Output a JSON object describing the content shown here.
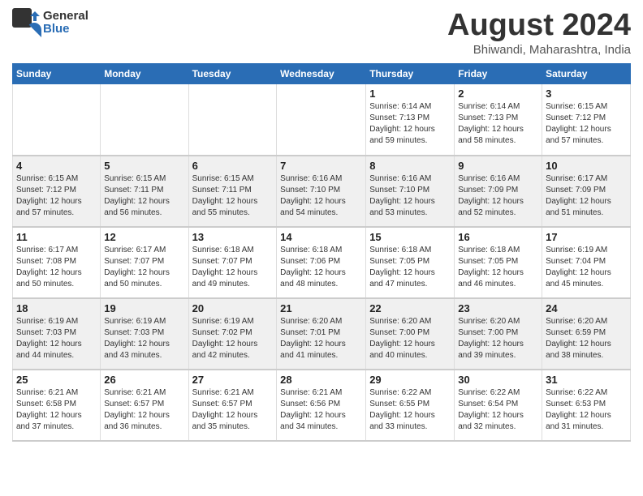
{
  "header": {
    "logo_general": "General",
    "logo_blue": "Blue",
    "main_title": "August 2024",
    "subtitle": "Bhiwandi, Maharashtra, India"
  },
  "weekdays": [
    "Sunday",
    "Monday",
    "Tuesday",
    "Wednesday",
    "Thursday",
    "Friday",
    "Saturday"
  ],
  "weeks": [
    {
      "days": [
        {
          "num": "",
          "info": ""
        },
        {
          "num": "",
          "info": ""
        },
        {
          "num": "",
          "info": ""
        },
        {
          "num": "",
          "info": ""
        },
        {
          "num": "1",
          "info": "Sunrise: 6:14 AM\nSunset: 7:13 PM\nDaylight: 12 hours\nand 59 minutes."
        },
        {
          "num": "2",
          "info": "Sunrise: 6:14 AM\nSunset: 7:13 PM\nDaylight: 12 hours\nand 58 minutes."
        },
        {
          "num": "3",
          "info": "Sunrise: 6:15 AM\nSunset: 7:12 PM\nDaylight: 12 hours\nand 57 minutes."
        }
      ]
    },
    {
      "days": [
        {
          "num": "4",
          "info": "Sunrise: 6:15 AM\nSunset: 7:12 PM\nDaylight: 12 hours\nand 57 minutes."
        },
        {
          "num": "5",
          "info": "Sunrise: 6:15 AM\nSunset: 7:11 PM\nDaylight: 12 hours\nand 56 minutes."
        },
        {
          "num": "6",
          "info": "Sunrise: 6:15 AM\nSunset: 7:11 PM\nDaylight: 12 hours\nand 55 minutes."
        },
        {
          "num": "7",
          "info": "Sunrise: 6:16 AM\nSunset: 7:10 PM\nDaylight: 12 hours\nand 54 minutes."
        },
        {
          "num": "8",
          "info": "Sunrise: 6:16 AM\nSunset: 7:10 PM\nDaylight: 12 hours\nand 53 minutes."
        },
        {
          "num": "9",
          "info": "Sunrise: 6:16 AM\nSunset: 7:09 PM\nDaylight: 12 hours\nand 52 minutes."
        },
        {
          "num": "10",
          "info": "Sunrise: 6:17 AM\nSunset: 7:09 PM\nDaylight: 12 hours\nand 51 minutes."
        }
      ]
    },
    {
      "days": [
        {
          "num": "11",
          "info": "Sunrise: 6:17 AM\nSunset: 7:08 PM\nDaylight: 12 hours\nand 50 minutes."
        },
        {
          "num": "12",
          "info": "Sunrise: 6:17 AM\nSunset: 7:07 PM\nDaylight: 12 hours\nand 50 minutes."
        },
        {
          "num": "13",
          "info": "Sunrise: 6:18 AM\nSunset: 7:07 PM\nDaylight: 12 hours\nand 49 minutes."
        },
        {
          "num": "14",
          "info": "Sunrise: 6:18 AM\nSunset: 7:06 PM\nDaylight: 12 hours\nand 48 minutes."
        },
        {
          "num": "15",
          "info": "Sunrise: 6:18 AM\nSunset: 7:05 PM\nDaylight: 12 hours\nand 47 minutes."
        },
        {
          "num": "16",
          "info": "Sunrise: 6:18 AM\nSunset: 7:05 PM\nDaylight: 12 hours\nand 46 minutes."
        },
        {
          "num": "17",
          "info": "Sunrise: 6:19 AM\nSunset: 7:04 PM\nDaylight: 12 hours\nand 45 minutes."
        }
      ]
    },
    {
      "days": [
        {
          "num": "18",
          "info": "Sunrise: 6:19 AM\nSunset: 7:03 PM\nDaylight: 12 hours\nand 44 minutes."
        },
        {
          "num": "19",
          "info": "Sunrise: 6:19 AM\nSunset: 7:03 PM\nDaylight: 12 hours\nand 43 minutes."
        },
        {
          "num": "20",
          "info": "Sunrise: 6:19 AM\nSunset: 7:02 PM\nDaylight: 12 hours\nand 42 minutes."
        },
        {
          "num": "21",
          "info": "Sunrise: 6:20 AM\nSunset: 7:01 PM\nDaylight: 12 hours\nand 41 minutes."
        },
        {
          "num": "22",
          "info": "Sunrise: 6:20 AM\nSunset: 7:00 PM\nDaylight: 12 hours\nand 40 minutes."
        },
        {
          "num": "23",
          "info": "Sunrise: 6:20 AM\nSunset: 7:00 PM\nDaylight: 12 hours\nand 39 minutes."
        },
        {
          "num": "24",
          "info": "Sunrise: 6:20 AM\nSunset: 6:59 PM\nDaylight: 12 hours\nand 38 minutes."
        }
      ]
    },
    {
      "days": [
        {
          "num": "25",
          "info": "Sunrise: 6:21 AM\nSunset: 6:58 PM\nDaylight: 12 hours\nand 37 minutes."
        },
        {
          "num": "26",
          "info": "Sunrise: 6:21 AM\nSunset: 6:57 PM\nDaylight: 12 hours\nand 36 minutes."
        },
        {
          "num": "27",
          "info": "Sunrise: 6:21 AM\nSunset: 6:57 PM\nDaylight: 12 hours\nand 35 minutes."
        },
        {
          "num": "28",
          "info": "Sunrise: 6:21 AM\nSunset: 6:56 PM\nDaylight: 12 hours\nand 34 minutes."
        },
        {
          "num": "29",
          "info": "Sunrise: 6:22 AM\nSunset: 6:55 PM\nDaylight: 12 hours\nand 33 minutes."
        },
        {
          "num": "30",
          "info": "Sunrise: 6:22 AM\nSunset: 6:54 PM\nDaylight: 12 hours\nand 32 minutes."
        },
        {
          "num": "31",
          "info": "Sunrise: 6:22 AM\nSunset: 6:53 PM\nDaylight: 12 hours\nand 31 minutes."
        }
      ]
    }
  ]
}
